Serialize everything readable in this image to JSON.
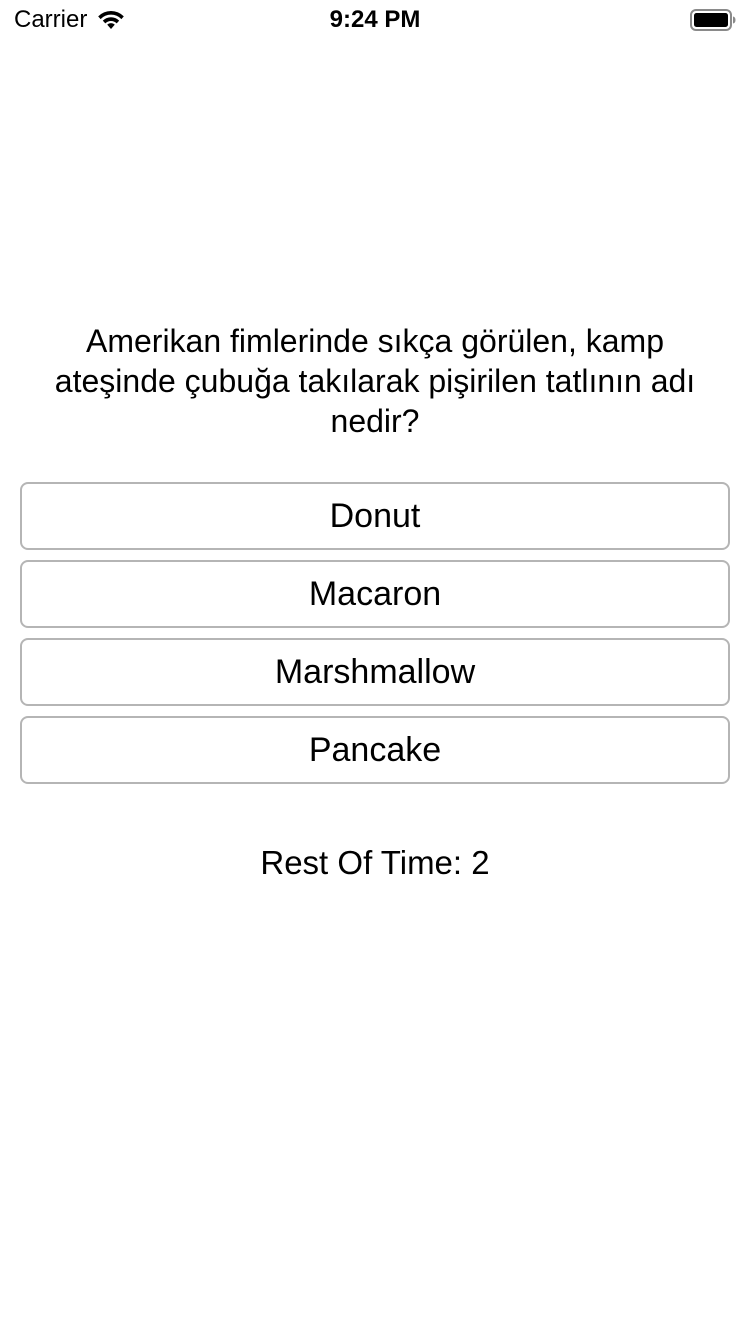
{
  "status_bar": {
    "carrier": "Carrier",
    "time": "9:24 PM",
    "wifi_icon": "wifi-icon",
    "battery_icon": "battery-full-icon"
  },
  "quiz": {
    "question": "Amerikan fimlerinde sıkça görülen, kamp ateşinde çubuğa takılarak pişirilen tatlının adı nedir?",
    "answers": [
      "Donut",
      "Macaron",
      "Marshmallow",
      "Pancake"
    ],
    "timer_label": "Rest Of Time:",
    "timer_value": "2"
  },
  "colors": {
    "background": "#ffffff",
    "text": "#000000",
    "button_border": "#b5b5b5"
  }
}
